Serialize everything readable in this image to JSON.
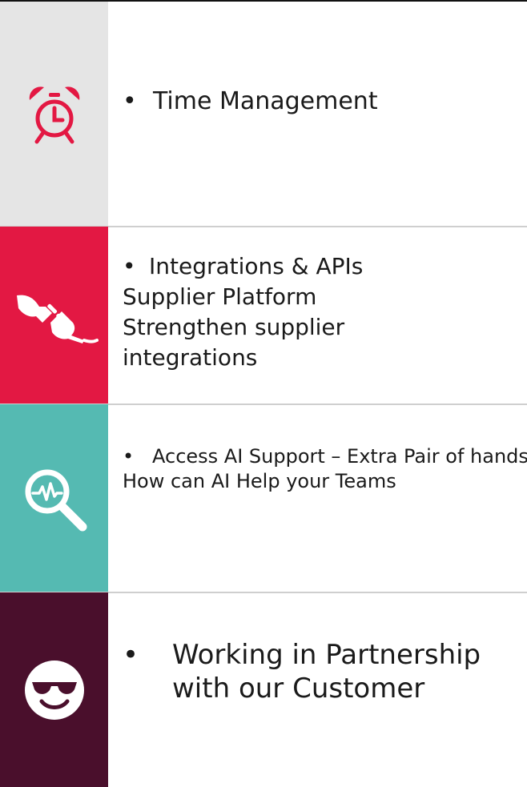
{
  "rows": [
    {
      "icon": "alarm-clock-icon",
      "color": "#e5e5e5",
      "bullet": "•",
      "bullet_text": "Time Management",
      "lines": []
    },
    {
      "icon": "plug-icon",
      "color": "#e31843",
      "bullet": "•",
      "bullet_text": "Integrations & APIs",
      "lines": [
        "Supplier Platform",
        "Strengthen supplier",
        "integrations"
      ]
    },
    {
      "icon": "magnifier-pulse-icon",
      "color": "#55bab2",
      "bullet": "•",
      "bullet_text": "Access AI Support – Extra Pair of hands",
      "lines": [
        "How can AI Help your Teams"
      ]
    },
    {
      "icon": "cool-face-sunglasses-icon",
      "color": "#4a0f2c",
      "bullet": "•",
      "bullet_text": "Working in Partnership with our Customer",
      "lines": []
    }
  ]
}
